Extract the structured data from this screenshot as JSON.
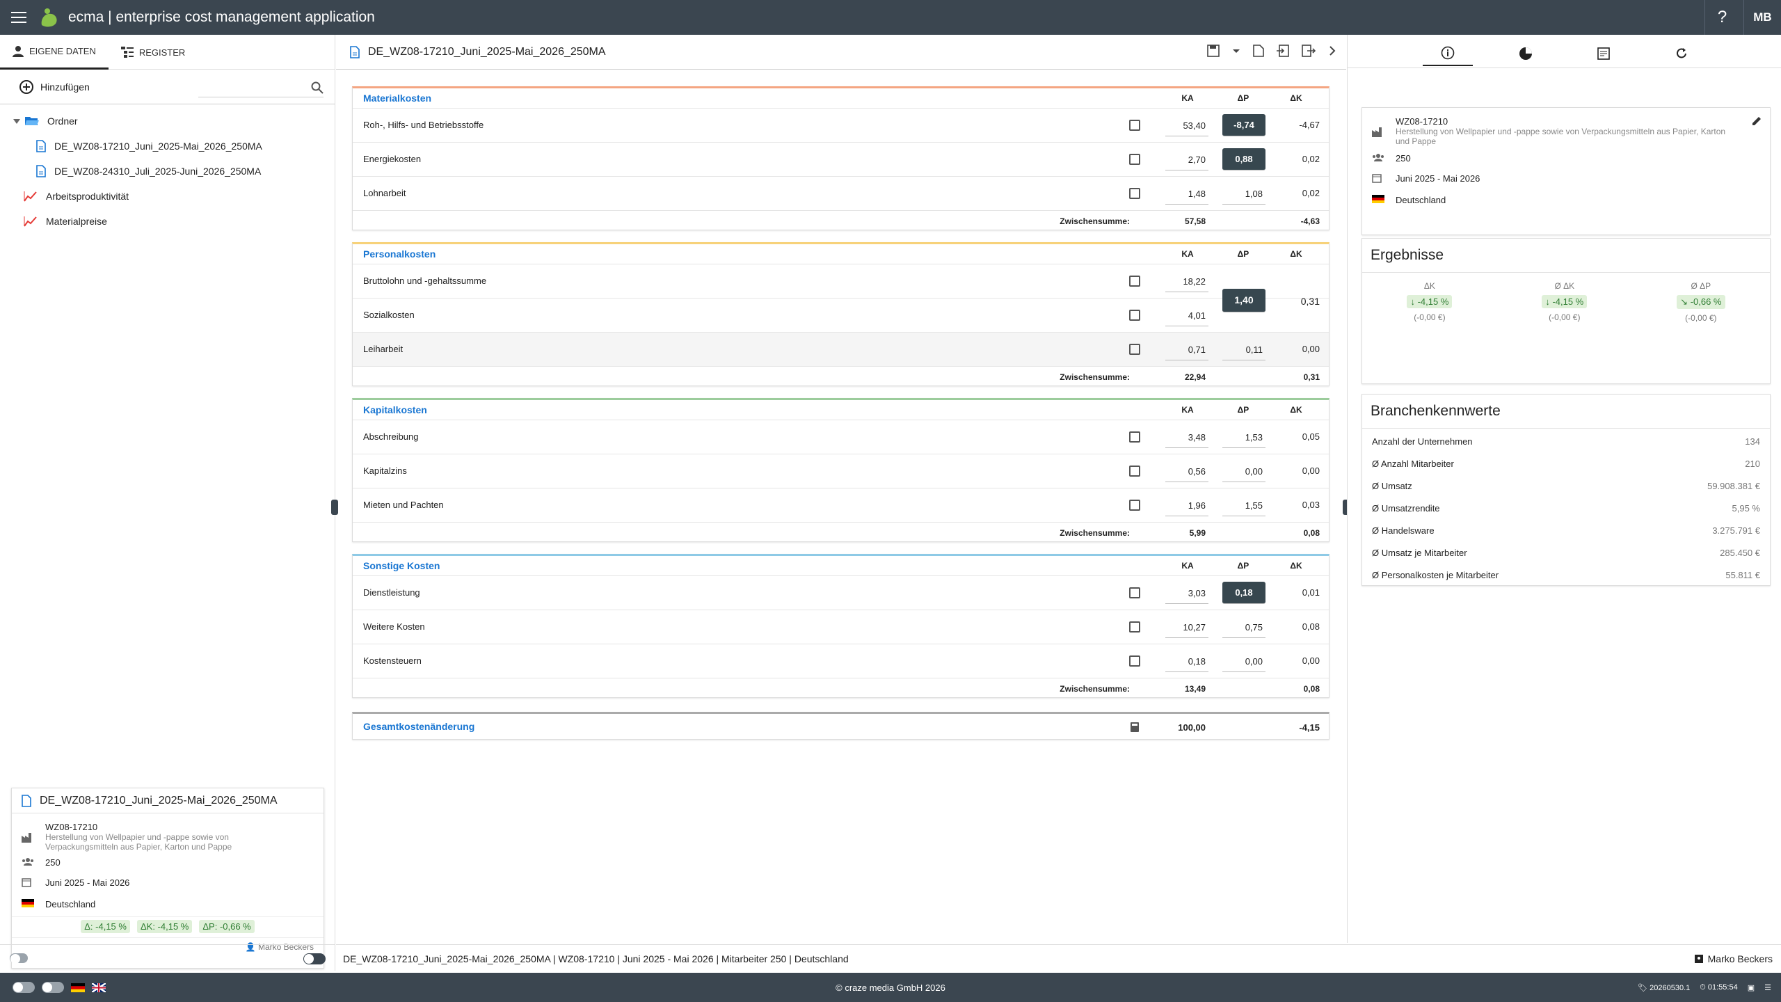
{
  "app": {
    "title": "ecma | enterprise cost management application",
    "user_initials": "MB",
    "help": "?"
  },
  "left": {
    "tabs": [
      {
        "label": "EIGENE DATEN"
      },
      {
        "label": "REGISTER"
      }
    ],
    "add_label": "Hinzufügen",
    "search_placeholder": "",
    "tree": [
      {
        "label": "Ordner"
      },
      {
        "label": "DE_WZ08-17210_Juni_2025-Mai_2026_250MA"
      },
      {
        "label": "DE_WZ08-24310_Juli_2025-Juni_2026_250MA"
      },
      {
        "label": "Arbeitsproduktivität"
      },
      {
        "label": "Materialpreise"
      }
    ],
    "card": {
      "title": "DE_WZ08-17210_Juni_2025-Mai_2026_250MA",
      "code": "WZ08-17210",
      "description": "Herstellung von Wellpapier und -pappe sowie von Verpackungsmitteln aus Papier, Karton und Pappe",
      "employees": "250",
      "period": "Juni 2025 - Mai 2026",
      "country": "Deutschland",
      "badges": [
        "Δ: -4,15 %",
        "ΔK: -4,15 %",
        "ΔP: -0,66 %"
      ],
      "author": "Marko Beckers"
    }
  },
  "center": {
    "doc_title": "DE_WZ08-17210_Juni_2025-Mai_2026_250MA",
    "col_headers": {
      "ka": "KA",
      "dp": "ΔP",
      "dk": "ΔK"
    },
    "subtotal_label": "Zwischensumme:",
    "sections": [
      {
        "title": "Materialkosten",
        "color": "#f4a582",
        "rows": [
          {
            "name": "Roh-, Hilfs- und Betriebsstoffe",
            "ka": "53,40",
            "dp": "-8,74",
            "dp_dark": true,
            "dk": "-4,67"
          },
          {
            "name": "Energiekosten",
            "ka": "2,70",
            "dp": "0,88",
            "dp_dark": true,
            "dk": "0,02"
          },
          {
            "name": "Lohnarbeit",
            "ka": "1,48",
            "dp": "1,08",
            "dp_dark": false,
            "dk": "0,02"
          }
        ],
        "sub_ka": "57,58",
        "sub_dk": "-4,63"
      },
      {
        "title": "Personalkosten",
        "color": "#f7d27a",
        "rows": [
          {
            "name": "Bruttolohn und -gehaltssumme",
            "ka": "18,22",
            "dp": "",
            "dp_dark": false,
            "dk": ""
          },
          {
            "name": "Sozialkosten",
            "ka": "4,01",
            "dp": "",
            "dp_dark": false,
            "dk": ""
          },
          {
            "name": "Leiharbeit",
            "ka": "0,71",
            "dp": "0,11",
            "dp_dark": false,
            "dk": "0,00"
          }
        ],
        "merged_dp": "1,40",
        "merged_dk": "0,31",
        "sub_ka": "22,94",
        "sub_dk": "0,31"
      },
      {
        "title": "Kapitalkosten",
        "color": "#9ccc9c",
        "rows": [
          {
            "name": "Abschreibung",
            "ka": "3,48",
            "dp": "1,53",
            "dp_dark": false,
            "dk": "0,05"
          },
          {
            "name": "Kapitalzins",
            "ka": "0,56",
            "dp": "0,00",
            "dp_dark": false,
            "dk": "0,00"
          },
          {
            "name": "Mieten und Pachten",
            "ka": "1,96",
            "dp": "1,55",
            "dp_dark": false,
            "dk": "0,03"
          }
        ],
        "sub_ka": "5,99",
        "sub_dk": "0,08"
      },
      {
        "title": "Sonstige Kosten",
        "color": "#8ecae6",
        "rows": [
          {
            "name": "Dienstleistung",
            "ka": "3,03",
            "dp": "0,18",
            "dp_dark": true,
            "dk": "0,01"
          },
          {
            "name": "Weitere Kosten",
            "ka": "10,27",
            "dp": "0,75",
            "dp_dark": false,
            "dk": "0,08"
          },
          {
            "name": "Kostensteuern",
            "ka": "0,18",
            "dp": "0,00",
            "dp_dark": false,
            "dk": "0,00"
          }
        ],
        "sub_ka": "13,49",
        "sub_dk": "0,08"
      }
    ],
    "total": {
      "label": "Gesamtkostenänderung",
      "ka": "100,00",
      "dk": "-4,15"
    }
  },
  "right": {
    "info": {
      "code": "WZ08-17210",
      "description": "Herstellung von Wellpapier und -pappe sowie von Verpackungsmitteln aus Papier, Karton und Pappe",
      "employees": "250",
      "period": "Juni 2025 - Mai 2026",
      "country": "Deutschland"
    },
    "results": {
      "title": "Ergebnisse",
      "cols": [
        {
          "label": "ΔK",
          "value": "-4,15 %",
          "sub": "(-0,00 €)"
        },
        {
          "label": "Ø ΔK",
          "value": "-4,15 %",
          "sub": "(-0,00 €)"
        },
        {
          "label": "Ø ΔP",
          "value": "-0,66 %",
          "sub": "(-0,00 €)"
        }
      ]
    },
    "industry": {
      "title": "Branchenkennwerte",
      "rows": [
        {
          "k": "Anzahl der Unternehmen",
          "v": "134"
        },
        {
          "k": "Ø Anzahl Mitarbeiter",
          "v": "210"
        },
        {
          "k": "Ø Umsatz",
          "v": "59.908.381 €"
        },
        {
          "k": "Ø Umsatzrendite",
          "v": "5,95 %"
        },
        {
          "k": "Ø Handelsware",
          "v": "3.275.791 €"
        },
        {
          "k": "Ø Umsatz je Mitarbeiter",
          "v": "285.450 €"
        },
        {
          "k": "Ø Personalkosten je Mitarbeiter",
          "v": "55.811 €"
        }
      ]
    }
  },
  "status": {
    "text": "DE_WZ08-17210_Juni_2025-Mai_2026_250MA | WZ08-17210 | Juni 2025 - Mai 2026 | Mitarbeiter 250 | Deutschland",
    "user": "Marko Beckers"
  },
  "footer": {
    "copyright": "© craze media GmbH 2026",
    "version": "20260530.1",
    "time": "01:55:54"
  }
}
